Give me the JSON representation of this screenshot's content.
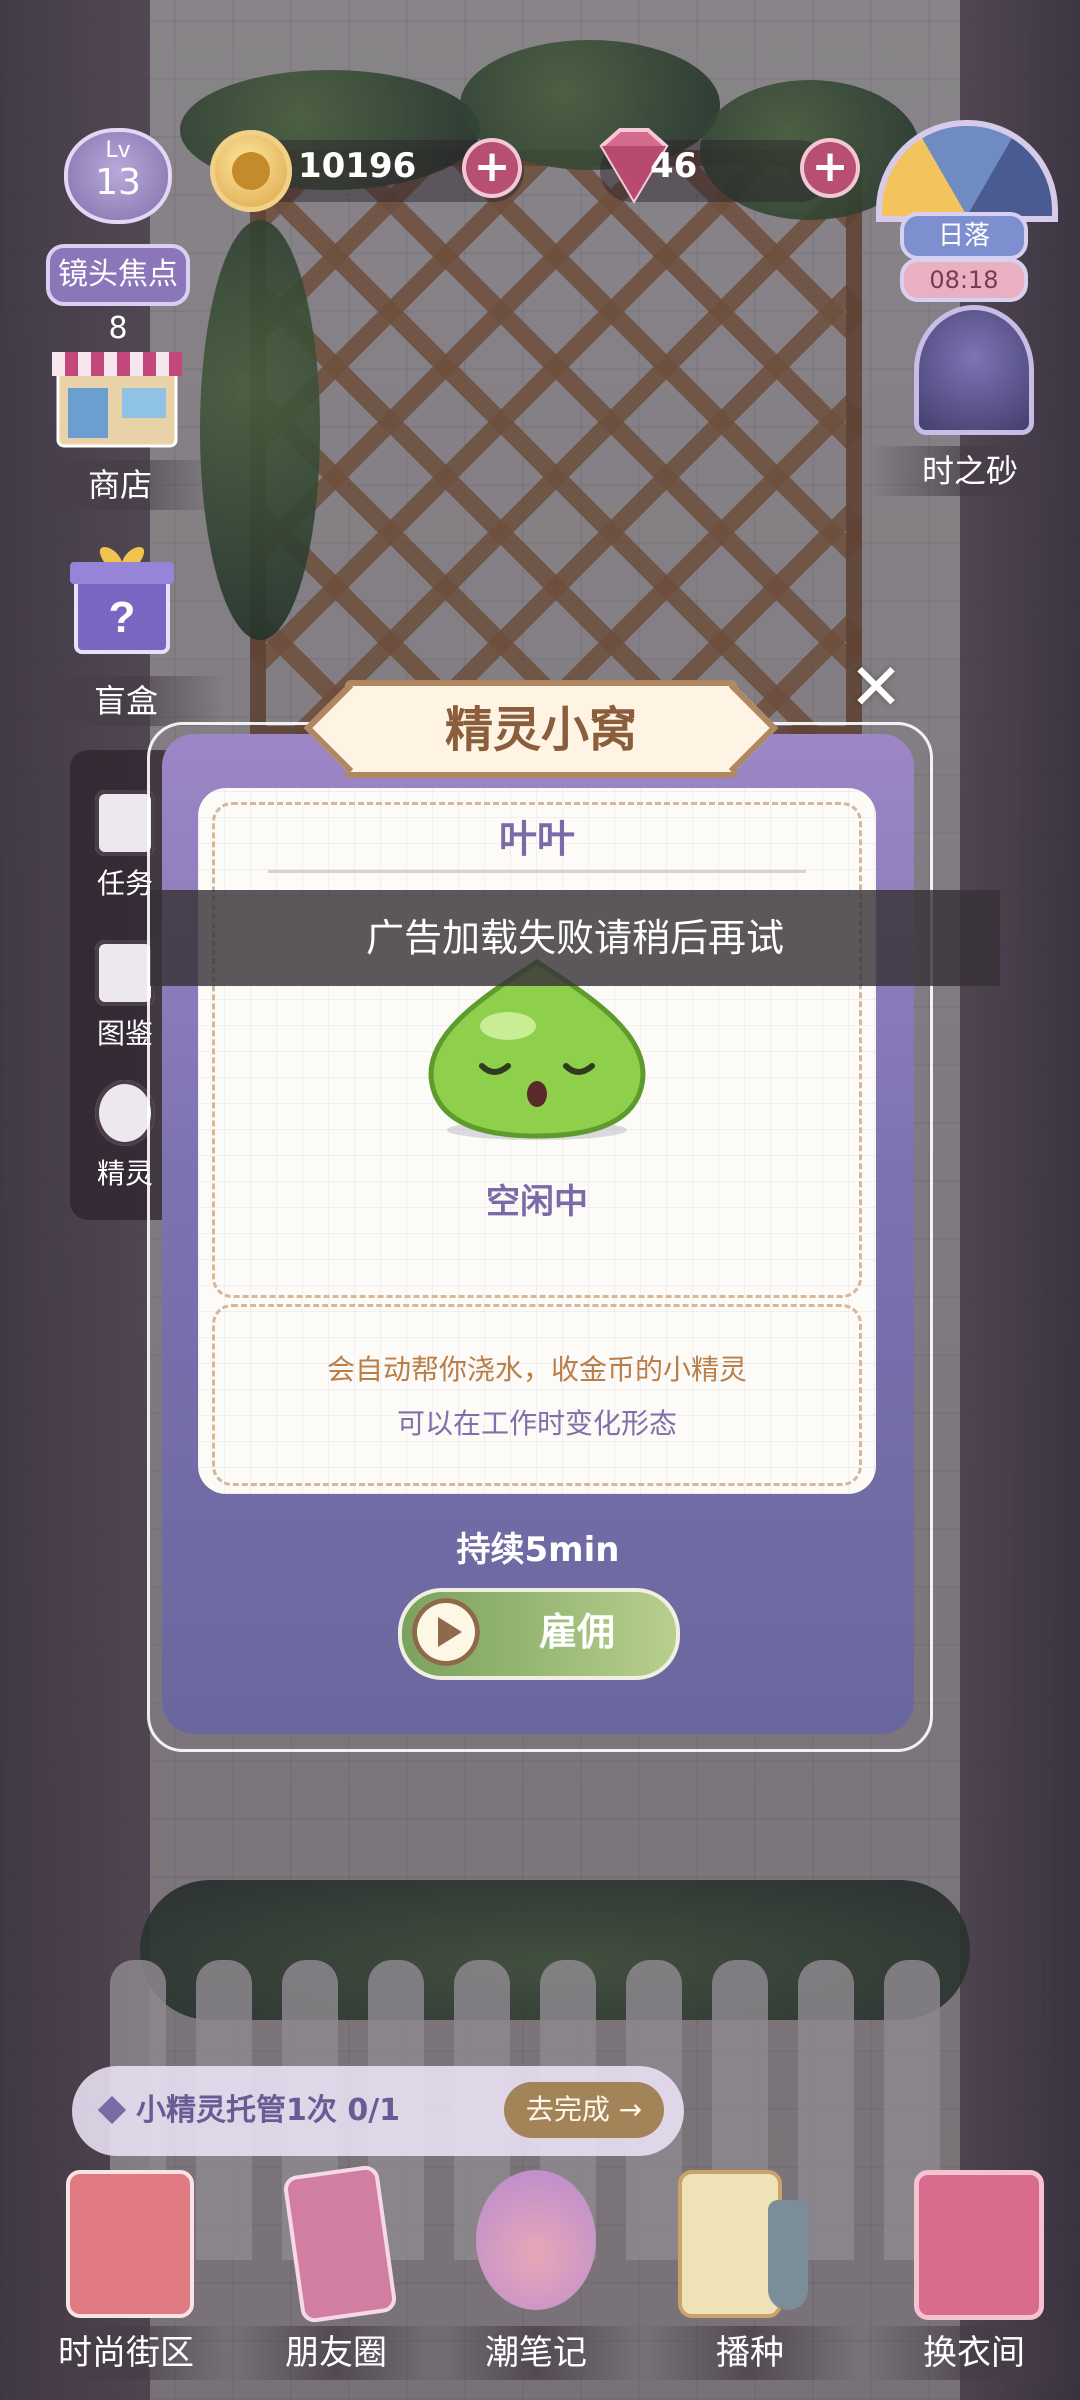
{
  "hud": {
    "level_prefix": "Lv",
    "level": "13",
    "focus_label": "镜头焦点8",
    "coins": "10196",
    "gems": "46",
    "time_phase": "日落",
    "time": "08:18",
    "hourglass_label": "时之砂"
  },
  "left_menu": {
    "shop": "商店",
    "blindbox": "盲盒"
  },
  "side_tabs": {
    "task": "任务",
    "atlas": "图鉴",
    "sprite": "精灵"
  },
  "toast": "广告加载失败请稍后再试",
  "modal": {
    "title": "精灵小窝",
    "sprite_name": "叶叶",
    "status": "空闲中",
    "desc_line1": "会自动帮你浇水，收金币的小精灵",
    "desc_line2": "可以在工作时变化形态",
    "duration": "持续5min",
    "hire_label": "雇佣",
    "close_symbol": "✕"
  },
  "task_bar": {
    "text": "小精灵托管1次  0/1",
    "go_label": "去完成 →"
  },
  "bottom_nav": [
    {
      "label": "时尚街区",
      "icon": "dress-card-icon"
    },
    {
      "label": "朋友圈",
      "icon": "phone-icon"
    },
    {
      "label": "潮笔记",
      "icon": "notebook-icon"
    },
    {
      "label": "播种",
      "icon": "seed-packet-icon"
    },
    {
      "label": "换衣间",
      "icon": "wardrobe-icon"
    }
  ],
  "colors": {
    "modal_purple": "#8d7dbd",
    "hire_green": "#8fb26c",
    "title_brown": "#8a5e3c",
    "accent_pink": "#b74f73"
  }
}
